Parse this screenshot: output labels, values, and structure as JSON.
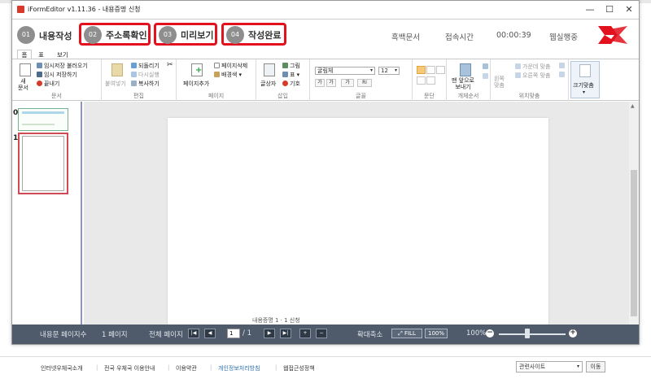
{
  "window": {
    "title": "iFormEditor v1.11.36 - 내용증명 신청",
    "minimize": "—",
    "maximize": "☐",
    "close": "✕"
  },
  "steps": [
    {
      "num": "01",
      "label": "내용작성",
      "highlighted": false
    },
    {
      "num": "02",
      "label": "주소록확인",
      "highlighted": true
    },
    {
      "num": "03",
      "label": "미리보기",
      "highlighted": true
    },
    {
      "num": "04",
      "label": "작성완료",
      "highlighted": true
    }
  ],
  "status": {
    "blank_doc": "흑백문서",
    "time_label": "접속시간",
    "time_value": "00:00:39",
    "state": "웹실행중"
  },
  "ribbon_tabs": [
    "홈",
    "표",
    "보기"
  ],
  "ribbon": {
    "doc": {
      "new": "새\n문서",
      "load_temp": "임시저장 불러오기",
      "temp_save": "임시 저장하기",
      "close": "끝내기",
      "title": "문서"
    },
    "edit": {
      "paste": "붙여넣기",
      "undo": "되돌리기",
      "redo": "다시실행",
      "copy": "복사하기",
      "cut": "✂",
      "title": "편집"
    },
    "page": {
      "add": "페이지추가",
      "delete": "페이지삭제",
      "bgcolor": "배경색",
      "title": "페이지"
    },
    "insert": {
      "textbox": "글상자",
      "image": "그림",
      "table": "표",
      "symbol": "기호",
      "title": "삽입"
    },
    "font": {
      "face": "굴림체",
      "size": "12",
      "bold": "가",
      "italic": "가",
      "color": "가",
      "highlight": "Ri",
      "title": "글꼴"
    },
    "paragraph": {
      "title": "문단"
    },
    "object_order": {
      "front": "맨 앞으로\n보내기",
      "title": "개체순서"
    },
    "position": {
      "left_align": "왼쪽\n맞춤",
      "center": "가운데 맞춤",
      "right": "오른쪽 맞춤",
      "title": "위치맞춤"
    },
    "fit": {
      "label": "크기맞춤"
    }
  },
  "thumbnails": [
    {
      "num": "0"
    },
    {
      "num": "1"
    }
  ],
  "page_footer_text": "내용증명 1 · 1 신청",
  "statusbar": {
    "page_count_label": "내용문 페이지수",
    "page_count_value": "1 페이지",
    "total_pages_label": "전체 페이지",
    "current_page": "1",
    "total_pages": "/ 1",
    "zoom_label": "확대축소",
    "fill": "FILL",
    "zoom_100": "100%",
    "zoom_value": "100%",
    "zoom_level": 0.43
  },
  "footer": {
    "links": [
      "인터넷우체국소개",
      "전국 우체국 이용안내",
      "이용약관",
      "개인정보처리방침",
      "웹접근성정책"
    ],
    "related": "관련사이트",
    "go": "이동"
  },
  "colors": {
    "accent_red": "#e3101d",
    "statusbar": "#4f5b6b",
    "privacy_link": "#2c6fb0"
  }
}
